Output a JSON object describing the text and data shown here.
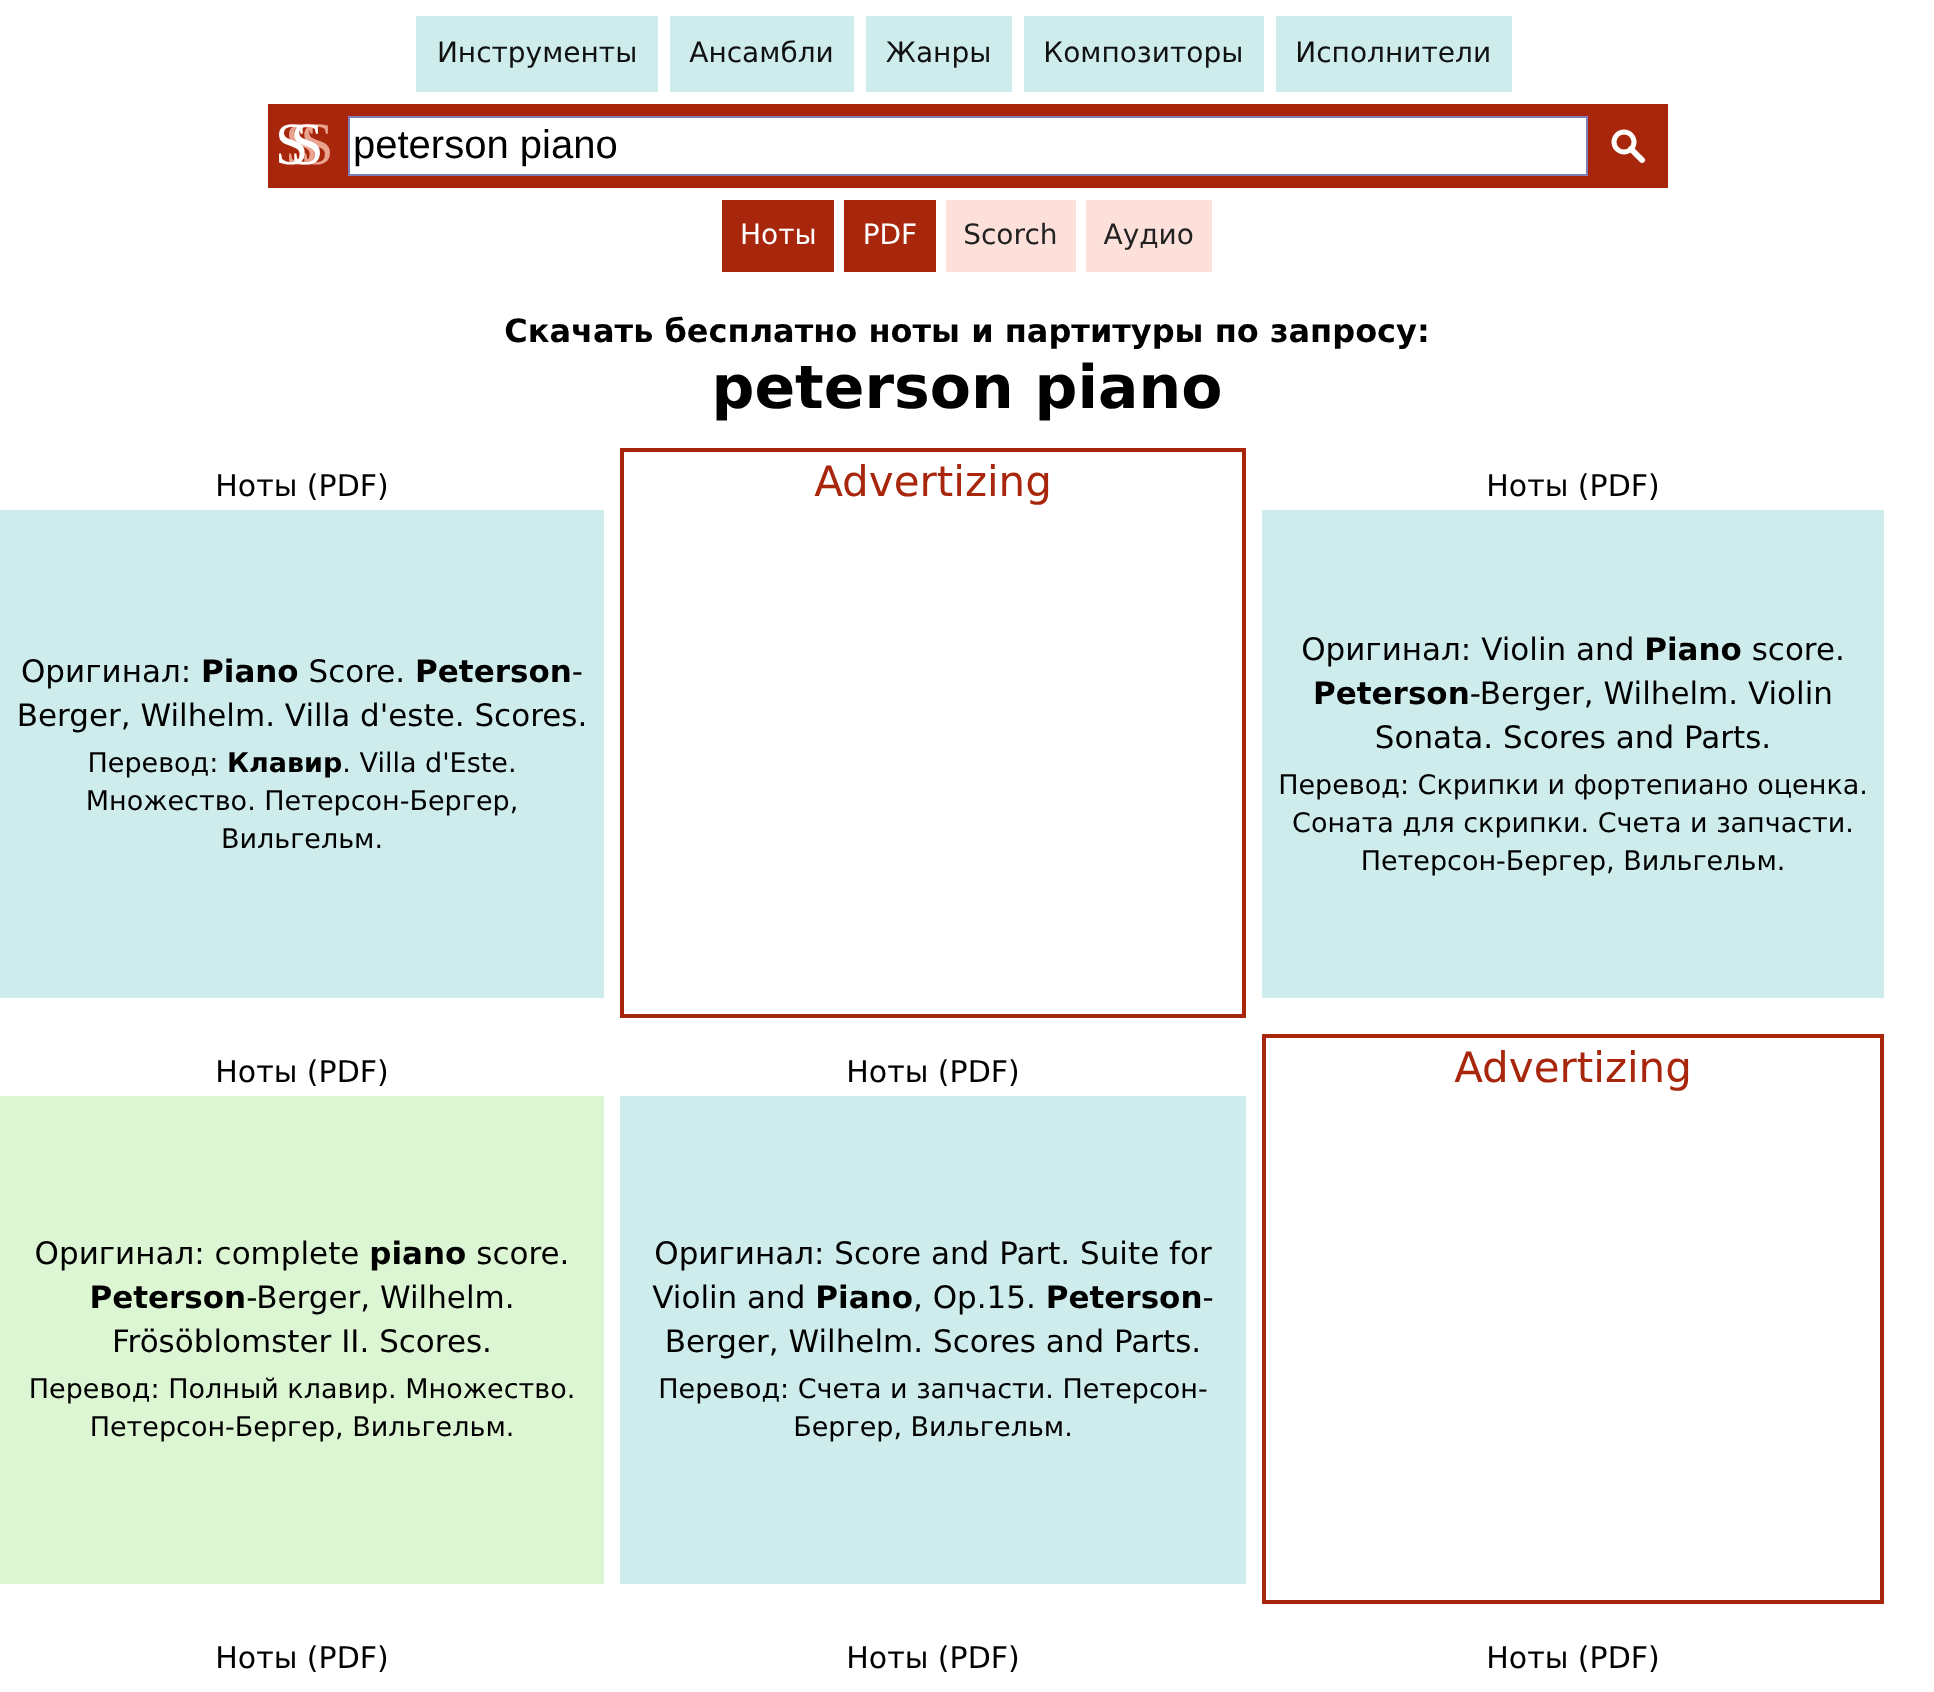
{
  "nav": [
    {
      "label": "Инструменты"
    },
    {
      "label": "Ансамбли"
    },
    {
      "label": "Жанры"
    },
    {
      "label": "Композиторы"
    },
    {
      "label": "Исполнители"
    }
  ],
  "search": {
    "logo": "SS",
    "value": "peterson piano"
  },
  "filters": [
    {
      "label": "Ноты",
      "selected": true
    },
    {
      "label": "PDF",
      "selected": true
    },
    {
      "label": "Scorch",
      "selected": false
    },
    {
      "label": "Аудио",
      "selected": false
    }
  ],
  "heading": {
    "subtitle": "Скачать бесплатно ноты и партитуры по запросу:",
    "query": "peterson piano"
  },
  "results": [
    {
      "kind": "score",
      "label": "Ноты (PDF)",
      "color": "#cdeceb",
      "original": "Оригинал: **Piano** Score. **Peterson**-Berger, Wilhelm. Villa d'este. Scores.",
      "translation": "Перевод: **Клавир**. Villa d'Este. Множество. Петерсон-Бергер, Вильгельм."
    },
    {
      "kind": "ad",
      "label": "Advertizing"
    },
    {
      "kind": "score",
      "label": "Ноты (PDF)",
      "color": "#cdeceb",
      "original": "Оригинал: Violin and **Piano** score. **Peterson**-Berger, Wilhelm. Violin Sonata. Scores and Parts.",
      "translation": "Перевод: Скрипки и фортепиано оценка. Соната для скрипки. Счета и запчасти. Петерсон-Бергер, Вильгельм."
    },
    {
      "kind": "score",
      "label": "Ноты (PDF)",
      "color": "#dcf6d4",
      "original": "Оригинал: complete **piano** score. **Peterson**-Berger, Wilhelm. Frösöblomster II. Scores.",
      "translation": "Перевод: Полный клавир. Множество. Петерсон-Бергер, Вильгельм."
    },
    {
      "kind": "score",
      "label": "Ноты (PDF)",
      "color": "#cdeceb",
      "original": "Оригинал: Score and Part. Suite for Violin and **Piano**, Op.15. **Peterson**-Berger, Wilhelm. Scores and Parts.",
      "translation": "Перевод: Счета и запчасти. Петерсон-Бергер, Вильгельм."
    },
    {
      "kind": "ad",
      "label": "Advertizing"
    },
    {
      "kind": "label",
      "label": "Ноты (PDF)"
    },
    {
      "kind": "label",
      "label": "Ноты (PDF)"
    },
    {
      "kind": "label",
      "label": "Ноты (PDF)"
    }
  ]
}
